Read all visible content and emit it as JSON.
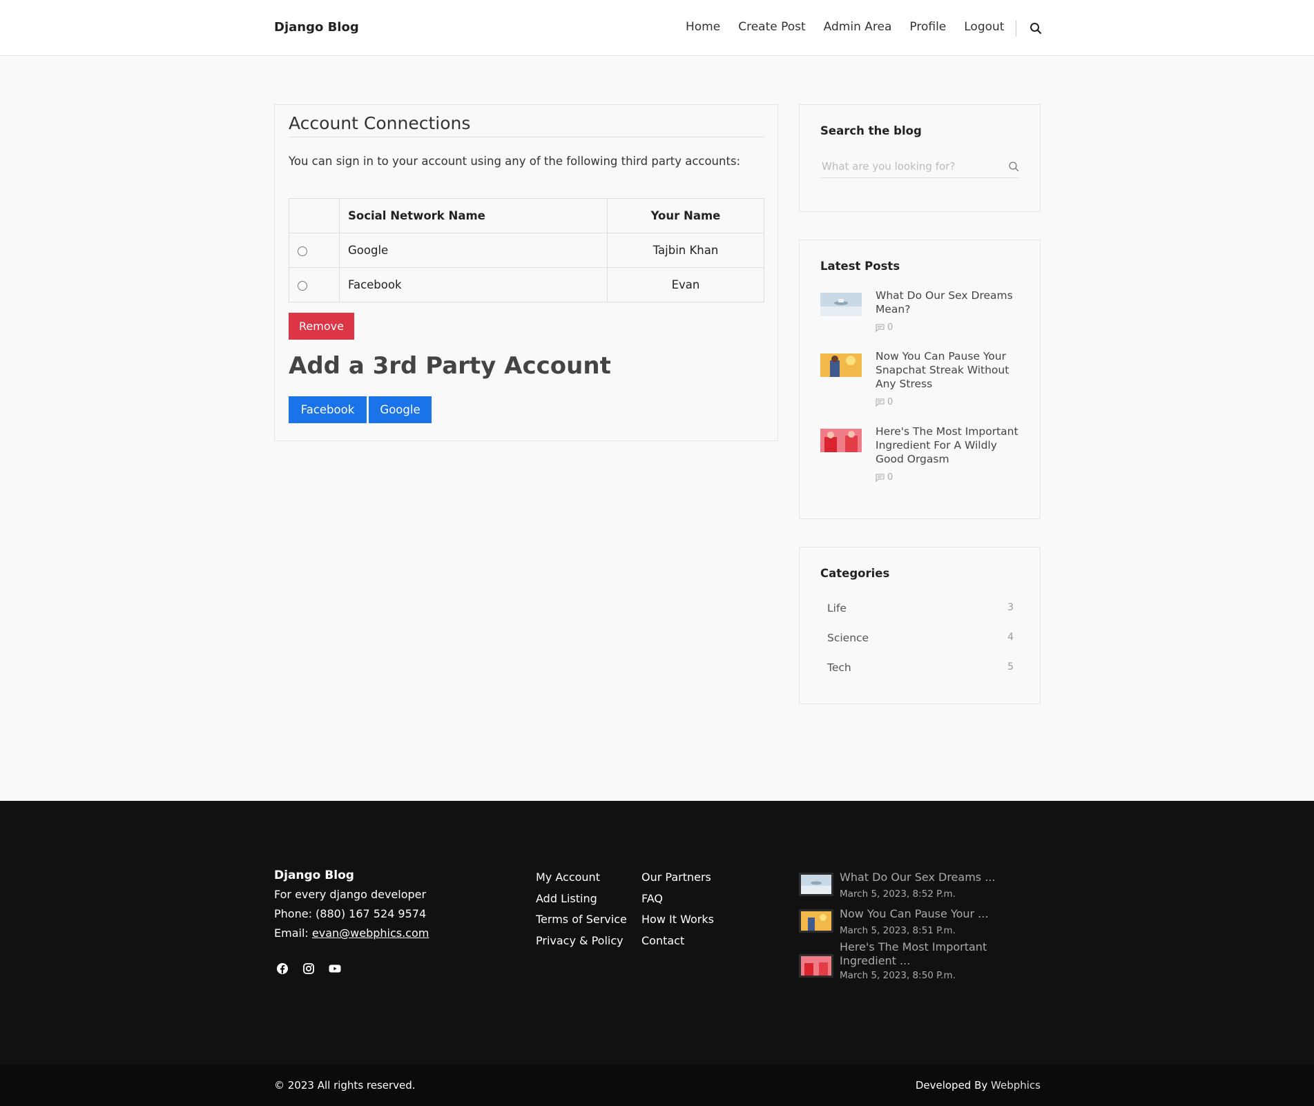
{
  "header": {
    "brand": "Django Blog",
    "nav": [
      "Home",
      "Create Post",
      "Admin Area",
      "Profile",
      "Logout"
    ]
  },
  "connections": {
    "title": "Account Connections",
    "intro": "You can sign in to your account using any of the following third party accounts:",
    "columns": [
      "Social Network Name",
      "Your Name"
    ],
    "rows": [
      {
        "network": "Google",
        "name": "Tajbin Khan"
      },
      {
        "network": "Facebook",
        "name": "Evan"
      }
    ],
    "remove_label": "Remove",
    "add_title": "Add a 3rd Party Account",
    "providers": [
      "Facebook",
      "Google"
    ]
  },
  "sidebar": {
    "search_title": "Search the blog",
    "search_placeholder": "What are you looking for?",
    "latest_title": "Latest Posts",
    "posts": [
      {
        "title": "What Do Our Sex Dreams Mean?",
        "comments": "0"
      },
      {
        "title": "Now You Can Pause Your Snapchat Streak Without Any Stress",
        "comments": "0"
      },
      {
        "title": "Here's The Most Important Ingredient For A Wildly Good Orgasm",
        "comments": "0"
      }
    ],
    "categories_title": "Categories",
    "categories": [
      {
        "name": "Life",
        "count": "3"
      },
      {
        "name": "Science",
        "count": "4"
      },
      {
        "name": "Tech",
        "count": "5"
      }
    ]
  },
  "footer": {
    "brand": "Django Blog",
    "tagline": "For every django developer",
    "phone": "Phone: (880) 167 524 9574",
    "email_label": "Email: ",
    "email": "evan@webphics.com",
    "links_col1": [
      "My Account",
      "Add Listing",
      "Terms of Service",
      "Privacy & Policy"
    ],
    "links_col2": [
      "Our Partners",
      "FAQ",
      "How It Works",
      "Contact"
    ],
    "recent": [
      {
        "title": "What Do Our Sex Dreams ...",
        "date": "March 5, 2023, 8:52 P.m."
      },
      {
        "title": "Now You Can Pause Your ...",
        "date": "March 5, 2023, 8:51 P.m."
      },
      {
        "title": "Here's The Most Important Ingredient ...",
        "date": "March 5, 2023, 8:50 P.m."
      }
    ],
    "copyright": "© 2023 All rights reserved.",
    "developed_by": "Developed By ",
    "developer": "Webphics"
  },
  "icons": [
    "search-icon",
    "comment-icon",
    "facebook-icon",
    "instagram-icon",
    "youtube-icon"
  ],
  "colors": {
    "danger": "#dc3545",
    "primary": "#1a73e8",
    "footer_bg": "#111111"
  }
}
